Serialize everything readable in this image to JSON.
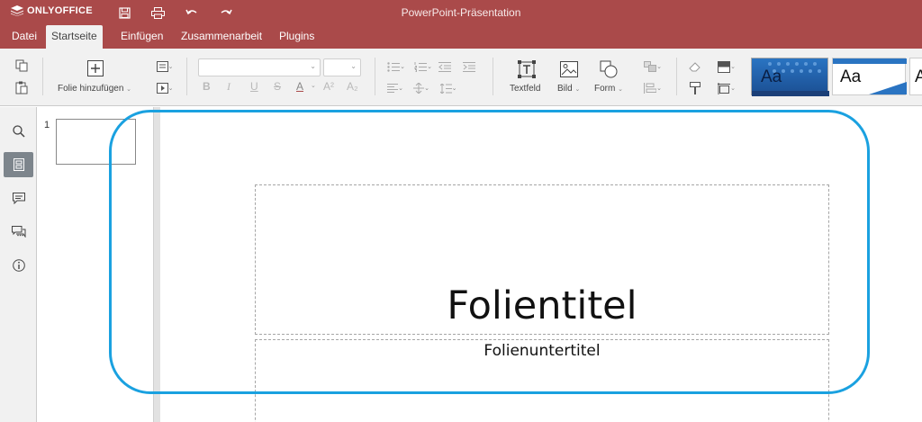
{
  "app": {
    "logo_text": "ONLYOFFICE",
    "document_title": "PowerPoint-Präsentation"
  },
  "colors": {
    "header_bg": "#aa4a4a",
    "toolbar_bg": "#f1f1f1",
    "highlight": "#1aa1e0",
    "theme_blue": "#2a74c2"
  },
  "quick_access": [
    {
      "name": "save-icon"
    },
    {
      "name": "print-icon"
    },
    {
      "name": "undo-icon"
    },
    {
      "name": "redo-icon"
    }
  ],
  "menu_tabs": [
    {
      "label": "Datei",
      "active": false
    },
    {
      "label": "Startseite",
      "active": true
    },
    {
      "label": "Einfügen",
      "active": false
    },
    {
      "label": "Zusammenarbeit",
      "active": false
    },
    {
      "label": "Plugins",
      "active": false
    }
  ],
  "toolbar": {
    "add_slide_label": "Folie hinzufügen",
    "textbox_label": "Textfeld",
    "image_label": "Bild",
    "shape_label": "Form",
    "font_name_value": "",
    "font_size_value": "",
    "format_buttons": [
      "B",
      "I",
      "U",
      "S",
      "A",
      "A²",
      "A₂"
    ],
    "themes": [
      {
        "label": "Aa"
      },
      {
        "label": "Aa"
      },
      {
        "label": "A"
      }
    ]
  },
  "left_rail": [
    {
      "name": "search-icon",
      "active": false
    },
    {
      "name": "slides-panel-icon",
      "active": true
    },
    {
      "name": "comments-icon",
      "active": false
    },
    {
      "name": "chat-icon",
      "active": false
    },
    {
      "name": "about-info-icon",
      "active": false
    }
  ],
  "slides_panel": {
    "slide_numbers": [
      "1"
    ]
  },
  "slide": {
    "title": "Folientitel",
    "subtitle": "Folienuntertitel"
  }
}
